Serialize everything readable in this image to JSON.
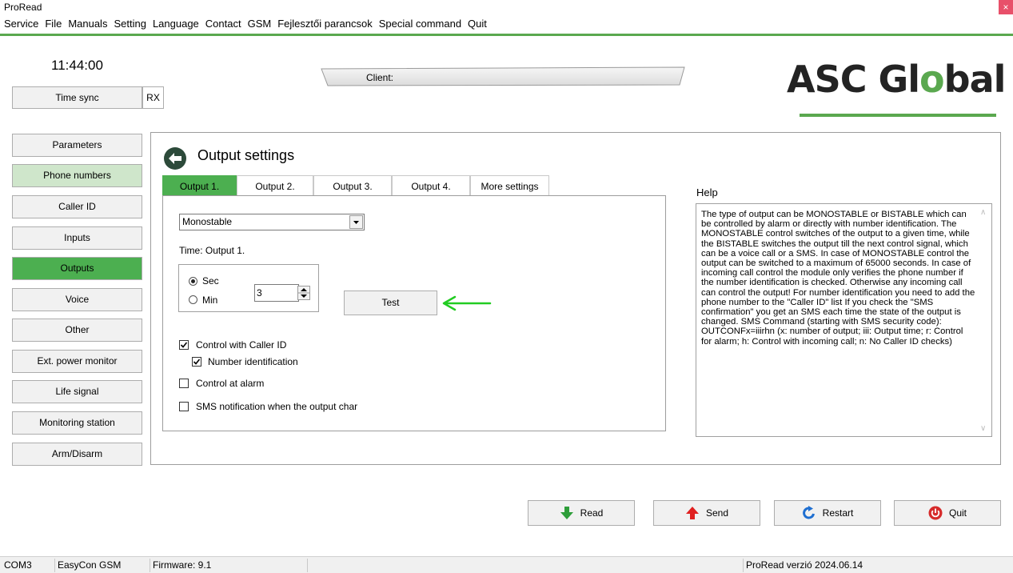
{
  "window": {
    "title": "ProRead",
    "close_glyph": "×"
  },
  "menu": [
    "Service",
    "File",
    "Manuals",
    "Setting",
    "Language",
    "Contact",
    "GSM",
    "Fejlesztői parancsok",
    "Special command",
    "Quit"
  ],
  "header": {
    "clock": "11:44:00",
    "time_sync_label": "Time sync",
    "rx_label": "RX",
    "client_label": "Client:",
    "logo": {
      "prefix": "ASC Gl",
      "o": "o",
      "suffix": "bal"
    }
  },
  "sidebar": {
    "items": [
      {
        "label": "Parameters",
        "state": "normal"
      },
      {
        "label": "Phone numbers",
        "state": "highlight"
      },
      {
        "label": "Caller ID",
        "state": "normal"
      },
      {
        "label": "Inputs",
        "state": "normal"
      },
      {
        "label": "Outputs",
        "state": "active"
      },
      {
        "label": "Voice",
        "state": "normal"
      },
      {
        "label": "Other",
        "state": "normal"
      },
      {
        "label": "Ext. power monitor",
        "state": "normal"
      },
      {
        "label": "Life signal",
        "state": "normal"
      },
      {
        "label": "Monitoring station",
        "state": "normal"
      },
      {
        "label": "Arm/Disarm",
        "state": "normal"
      }
    ]
  },
  "main": {
    "title": "Output settings",
    "tabs": [
      {
        "label": "Output 1.",
        "active": true
      },
      {
        "label": "Output 2.",
        "active": false
      },
      {
        "label": "Output 3.",
        "active": false
      },
      {
        "label": "Output 4.",
        "active": false
      },
      {
        "label": "More settings",
        "active": false
      }
    ],
    "mode_select": {
      "value": "Monostable"
    },
    "time_label": "Time: Output 1.",
    "time_unit": {
      "sec_label": "Sec",
      "min_label": "Min",
      "selected": "Sec"
    },
    "time_value": "3",
    "test_label": "Test",
    "options": {
      "control_caller_id": {
        "label": "Control with Caller ID",
        "checked": true
      },
      "number_identification": {
        "label": "Number identification",
        "checked": true
      },
      "control_at_alarm": {
        "label": "Control at alarm",
        "checked": false
      },
      "sms_notification": {
        "label": "SMS notification when the output char",
        "checked": false
      }
    }
  },
  "help": {
    "label": "Help",
    "text": "The type of output can be MONOSTABLE or BISTABLE which can be controlled by alarm or directly with number identification.  The MONOSTABLE control switches of the output to a given time, while the BISTABLE switches the output till the next control signal, which can be a voice call or a SMS. In case of MONOSTABLE control the output can be switched to a maximum of 65000 seconds. In case of incoming call control the module only verifies the phone number if the number identification is checked. Otherwise any incoming call can control the output! For number identification you need to add the phone number to the \"Caller ID\" list If you check the \"SMS confirmation\" you get an SMS each time the state of the output is changed. SMS Command (starting with SMS security code): OUTCONFx=iiirhn (x: number of output; iii: Output time; r: Control for alarm; h: Control with incoming call; n: No Caller ID checks)"
  },
  "actions": {
    "read_label": "Read",
    "send_label": "Send",
    "restart_label": "Restart",
    "quit_label": "Quit"
  },
  "status": {
    "port": "COM3",
    "device": "EasyCon GSM",
    "firmware": "Firmware: 9.1",
    "version": "ProRead verzió 2024.06.14"
  },
  "colors": {
    "accent_green": "#4caf50",
    "light_green": "#cfe6cb",
    "close_red": "#e8506a",
    "annotation_green": "#22cc22"
  }
}
